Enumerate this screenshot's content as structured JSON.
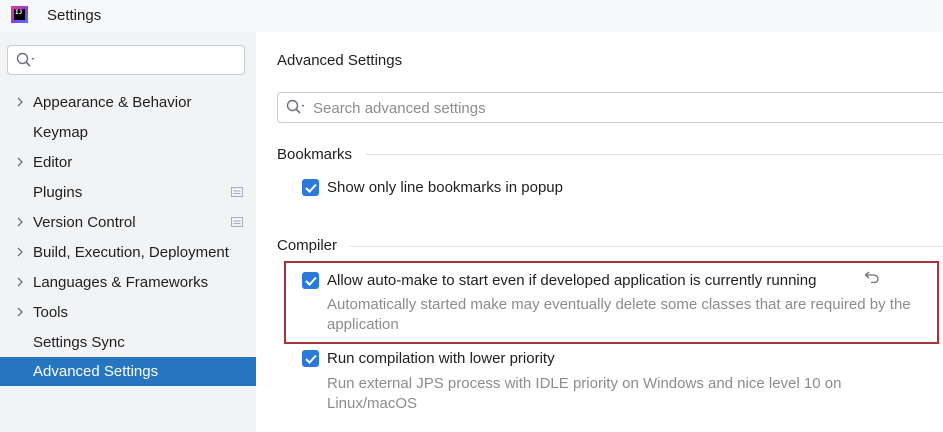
{
  "window": {
    "title": "Settings",
    "app_icon_text": "IJ"
  },
  "sidebar": {
    "search": {
      "placeholder": ""
    },
    "items": [
      {
        "label": "Appearance & Behavior",
        "expandable": true,
        "badge": false,
        "selected": false
      },
      {
        "label": "Keymap",
        "expandable": false,
        "badge": false,
        "selected": false
      },
      {
        "label": "Editor",
        "expandable": true,
        "badge": false,
        "selected": false
      },
      {
        "label": "Plugins",
        "expandable": false,
        "badge": true,
        "selected": false
      },
      {
        "label": "Version Control",
        "expandable": true,
        "badge": true,
        "selected": false
      },
      {
        "label": "Build, Execution, Deployment",
        "expandable": true,
        "badge": false,
        "selected": false
      },
      {
        "label": "Languages & Frameworks",
        "expandable": true,
        "badge": false,
        "selected": false
      },
      {
        "label": "Tools",
        "expandable": true,
        "badge": false,
        "selected": false
      },
      {
        "label": "Settings Sync",
        "expandable": false,
        "badge": false,
        "selected": false
      },
      {
        "label": "Advanced Settings",
        "expandable": false,
        "badge": false,
        "selected": true
      }
    ]
  },
  "main": {
    "title": "Advanced Settings",
    "search": {
      "placeholder": "Search advanced settings"
    },
    "sections": [
      {
        "header": "Bookmarks",
        "options": [
          {
            "label": "Show only line bookmarks in popup",
            "checked": true,
            "description": ""
          }
        ]
      },
      {
        "header": "Compiler",
        "options": [
          {
            "label": "Allow auto-make to start even if developed application is currently running",
            "checked": true,
            "modified": true,
            "description": "Automatically started make may eventually delete some classes that are required by the application"
          },
          {
            "label": "Run compilation with lower priority",
            "checked": true,
            "description": "Run external JPS process with IDLE priority on Windows and nice level 10 on Linux/macOS"
          }
        ]
      }
    ]
  },
  "colors": {
    "accent": "#2675bf",
    "checkbox": "#2b79d8",
    "highlight_border": "#a9343a",
    "sidebar_bg": "#f2f3f5",
    "description_text": "#8c8c8c"
  }
}
